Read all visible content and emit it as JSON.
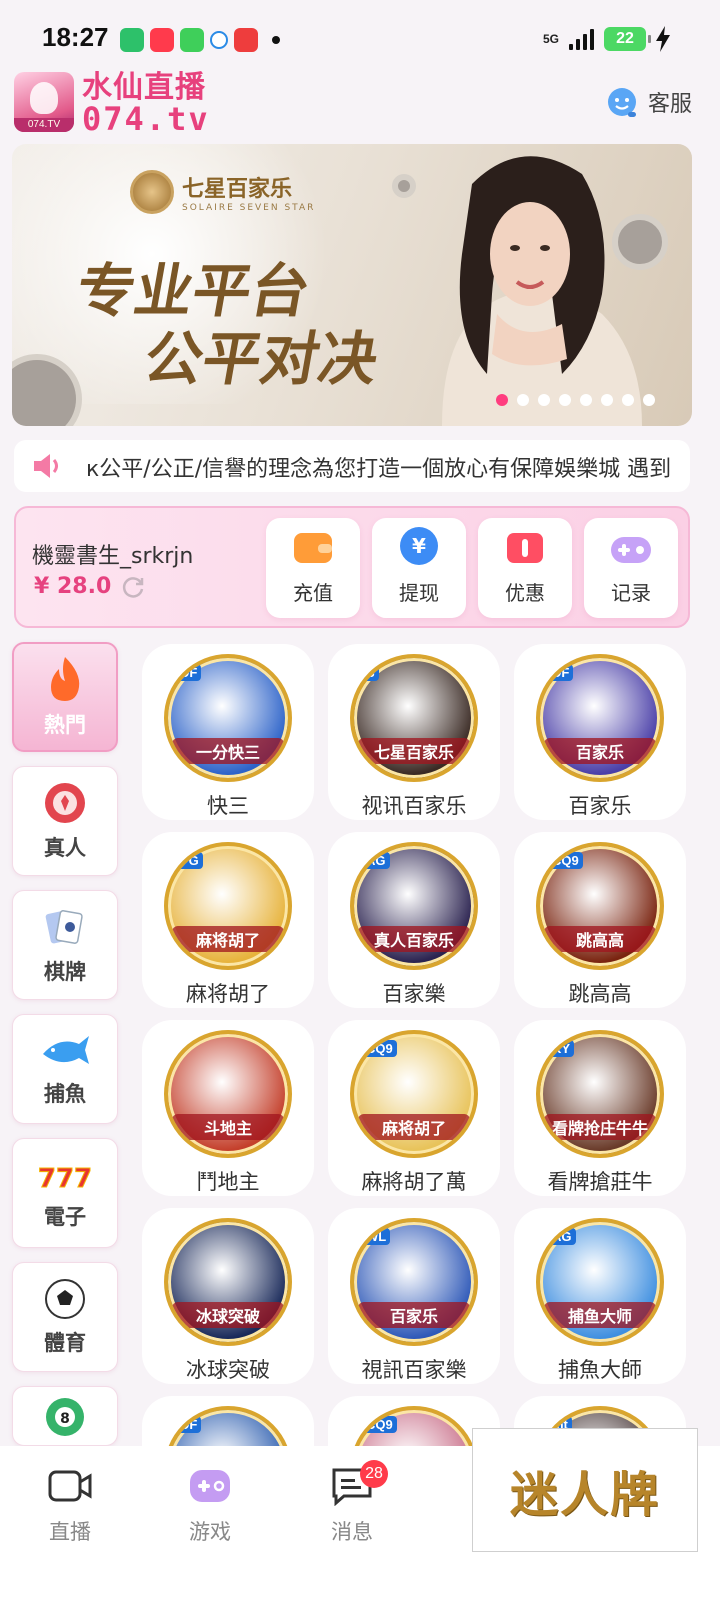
{
  "status_bar": {
    "time": "18:27",
    "network": "5G",
    "battery": "22"
  },
  "header": {
    "brand_name": "水仙直播",
    "brand_domain": "074.tv",
    "logo_tag": "074.TV",
    "support_label": "客服"
  },
  "banner": {
    "brand": "七星百家乐",
    "brand_sub": "SOLAIRE SEVEN STAR",
    "slogan_line1": "专业平台",
    "slogan_line2": "公平对决",
    "slide_count": 8,
    "active_slide": 1
  },
  "marquee": {
    "text": "к公平/公正/信譽的理念為您打造一個放心有保障娛樂城 遇到"
  },
  "wallet": {
    "username": "機靈書生_srkrjn",
    "balance": "¥ 28.0",
    "actions": [
      {
        "label": "充值",
        "icon": "wallet-icon",
        "color": "#ff9c38"
      },
      {
        "label": "提现",
        "icon": "yuan-coin-icon",
        "color": "#3d8cf5"
      },
      {
        "label": "优惠",
        "icon": "ticket-icon",
        "color": "#ff4e63"
      },
      {
        "label": "记录",
        "icon": "gamepad-icon",
        "color": "#b98cf5"
      }
    ]
  },
  "categories": [
    {
      "label": "熱門",
      "icon": "flame-icon",
      "active": true
    },
    {
      "label": "真人",
      "icon": "poker-chip-icon",
      "active": false
    },
    {
      "label": "棋牌",
      "icon": "playing-cards-icon",
      "active": false
    },
    {
      "label": "捕魚",
      "icon": "shark-icon",
      "active": false
    },
    {
      "label": "電子",
      "icon": "slot-777-icon",
      "active": false
    },
    {
      "label": "體育",
      "icon": "soccer-ball-icon",
      "active": false
    },
    {
      "label": "",
      "icon": "lottery-ball-icon",
      "active": false
    }
  ],
  "games": [
    {
      "name": "快三",
      "badge": "DF",
      "art_title": "一分快三",
      "bg": "#2d63c9"
    },
    {
      "name": "视讯百家乐",
      "badge": "S",
      "art_title": "七星百家乐",
      "bg": "#3a2a24"
    },
    {
      "name": "百家乐",
      "badge": "DF",
      "art_title": "百家乐",
      "bg": "#4a3fa8"
    },
    {
      "name": "麻将胡了",
      "badge": "PG",
      "art_title": "麻将胡了",
      "bg": "#e7b33c"
    },
    {
      "name": "百家樂",
      "badge": "AG",
      "art_title": "真人百家乐",
      "bg": "#2b2350"
    },
    {
      "name": "跳高高",
      "badge": "CQ9",
      "art_title": "跳高高",
      "bg": "#7a2410"
    },
    {
      "name": "鬥地主",
      "badge": "",
      "art_title": "斗地主",
      "bg": "#c4402c"
    },
    {
      "name": "麻將胡了萬",
      "badge": "CQ9",
      "art_title": "麻将胡了",
      "bg": "#e8c35a"
    },
    {
      "name": "看牌搶莊牛",
      "badge": "KY",
      "art_title": "看牌抢庄牛牛",
      "bg": "#6a3b2a"
    },
    {
      "name": "冰球突破",
      "badge": "",
      "art_title": "冰球突破",
      "bg": "#1a2a5a"
    },
    {
      "name": "視訊百家樂",
      "badge": "WL",
      "art_title": "百家乐",
      "bg": "#2f59b8"
    },
    {
      "name": "捕魚大師",
      "badge": "AG",
      "art_title": "捕鱼大师",
      "bg": "#3f8fe0"
    },
    {
      "name": "",
      "badge": "DF",
      "art_title": "",
      "bg": "#2e5fb0"
    },
    {
      "name": "",
      "badge": "CQ9",
      "art_title": "",
      "bg": "#c9708a"
    },
    {
      "name": "",
      "badge": "mt",
      "art_title": "",
      "bg": "#4a3a3a"
    }
  ],
  "tabbar": {
    "tabs": [
      {
        "label": "直播",
        "icon": "video-camera-icon"
      },
      {
        "label": "游戏",
        "icon": "gamepad-icon"
      },
      {
        "label": "消息",
        "icon": "message-icon"
      }
    ],
    "message_badge": "28"
  },
  "watermark": "迷人牌",
  "colors": {
    "accent": "#e7417d",
    "page_bg": "#f7f3f7",
    "wallet_bg": "#fbd0e5"
  }
}
